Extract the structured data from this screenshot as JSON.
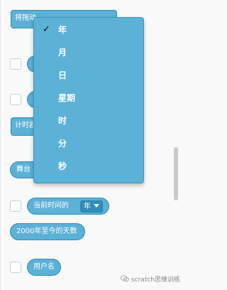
{
  "palette": {
    "sensing_block": "#5cb1d6",
    "sensing_border": "#2e8eb8",
    "dropdown_bg": "#5cb1d6",
    "checkbox_border": "#c8cfd9",
    "scrollbar": "#c9c9c9"
  },
  "blocks": {
    "drag_mode_label": "将拖动",
    "timer_label": "计时器",
    "stage_label": "舞台",
    "current_time": {
      "label": "当前时间的",
      "selected": "年"
    },
    "days_since_2000": "2000年至今的天数",
    "username": "用户名"
  },
  "dropdown": {
    "items": [
      {
        "label": "年",
        "checked": true
      },
      {
        "label": "月",
        "checked": false
      },
      {
        "label": "日",
        "checked": false
      },
      {
        "label": "星期",
        "checked": false
      },
      {
        "label": "时",
        "checked": false
      },
      {
        "label": "分",
        "checked": false
      },
      {
        "label": "秒",
        "checked": false
      }
    ],
    "check_symbol": "✓"
  },
  "watermark": {
    "text": "scratch思维训练",
    "icon": "wechat-icon"
  }
}
